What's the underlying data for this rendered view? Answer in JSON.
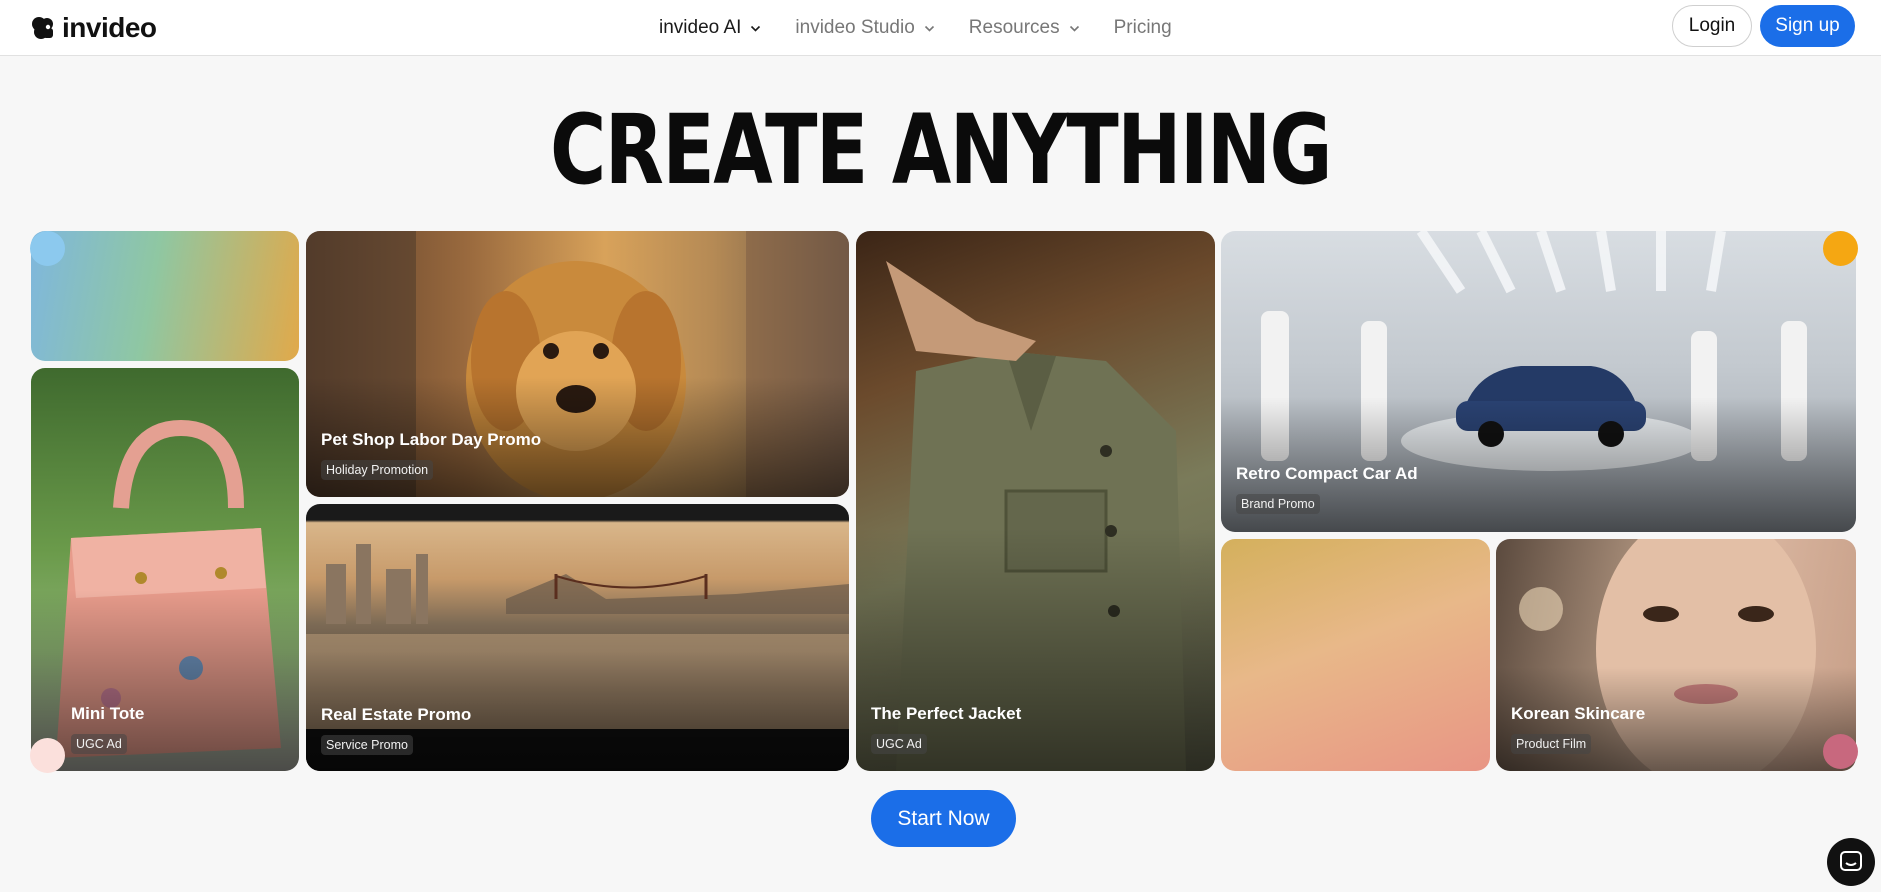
{
  "brand": {
    "name": "invideo"
  },
  "nav": {
    "items": [
      {
        "label": "invideo AI",
        "dropdown": true
      },
      {
        "label": "invideo Studio",
        "dropdown": true
      },
      {
        "label": "Resources",
        "dropdown": true
      },
      {
        "label": "Pricing",
        "dropdown": false
      }
    ]
  },
  "auth": {
    "login_label": "Login",
    "signup_label": "Sign up"
  },
  "hero": {
    "title": "CREATE ANYTHING"
  },
  "tiles": [
    {
      "title": "Pet Shop Labor Day Promo",
      "tag": "Holiday Promotion"
    },
    {
      "title": "Retro Compact Car Ad",
      "tag": "Brand Promo"
    },
    {
      "title": "Mini Tote",
      "tag": "UGC Ad"
    },
    {
      "title": "Real Estate Promo",
      "tag": "Service Promo"
    },
    {
      "title": "The Perfect Jacket",
      "tag": "UGC Ad"
    },
    {
      "title": "Korean Skincare",
      "tag": "Product Film"
    }
  ],
  "cta": {
    "label": "Start Now"
  },
  "colors": {
    "accent": "#1b6ee8",
    "background": "#f7f7f7"
  },
  "icons": {
    "logo": "invideo-logo-icon",
    "chat": "chat-icon",
    "dropdown": "chevron-down-icon"
  }
}
